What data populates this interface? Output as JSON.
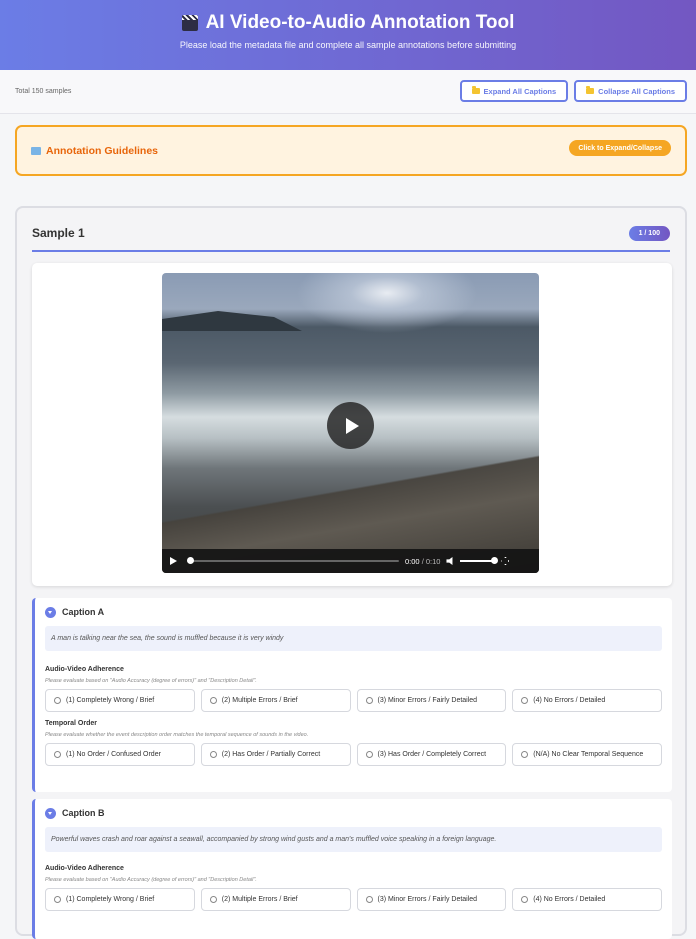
{
  "header": {
    "title": "AI Video-to-Audio Annotation Tool",
    "subtitle": "Please load the metadata file and complete all sample annotations before submitting",
    "icon": "clapperboard-icon"
  },
  "toolbar": {
    "total": "Total 150 samples",
    "expand_all": "Expand All Captions",
    "collapse_all": "Collapse All Captions"
  },
  "guidelines": {
    "title": "Annotation Guidelines",
    "toggle_label": "Click to Expand/Collapse"
  },
  "sample": {
    "title": "Sample 1",
    "badge": "1 / 100",
    "video": {
      "current_time": "0:00",
      "duration": "/ 0:10"
    }
  },
  "captions": [
    {
      "label": "Caption A",
      "text": "A man is talking near the sea, the sound is muffled because it is very windy",
      "questions": [
        {
          "title": "Audio-Video Adherence",
          "desc": "Please evaluate based on \"Audio Accuracy (degree of errors)\" and \"Description Detail\".",
          "options": [
            "(1) Completely Wrong / Brief",
            "(2) Multiple Errors / Brief",
            "(3) Minor Errors / Fairly Detailed",
            "(4) No Errors / Detailed"
          ]
        },
        {
          "title": "Temporal Order",
          "desc": "Please evaluate whether the event description order matches the temporal sequence of sounds in the video.",
          "options": [
            "(1) No Order / Confused Order",
            "(2) Has Order / Partially Correct",
            "(3) Has Order / Completely Correct",
            "(N/A) No Clear Temporal Sequence"
          ]
        }
      ]
    },
    {
      "label": "Caption B",
      "text": "Powerful waves crash and roar against a seawall, accompanied by strong wind gusts and a man's muffled voice speaking in a foreign language.",
      "questions": [
        {
          "title": "Audio-Video Adherence",
          "desc": "Please evaluate based on \"Audio Accuracy (degree of errors)\" and \"Description Detail\".",
          "options": [
            "(1) Completely Wrong / Brief",
            "(2) Multiple Errors / Brief",
            "(3) Minor Errors / Fairly Detailed",
            "(4) No Errors / Detailed"
          ]
        }
      ]
    }
  ]
}
